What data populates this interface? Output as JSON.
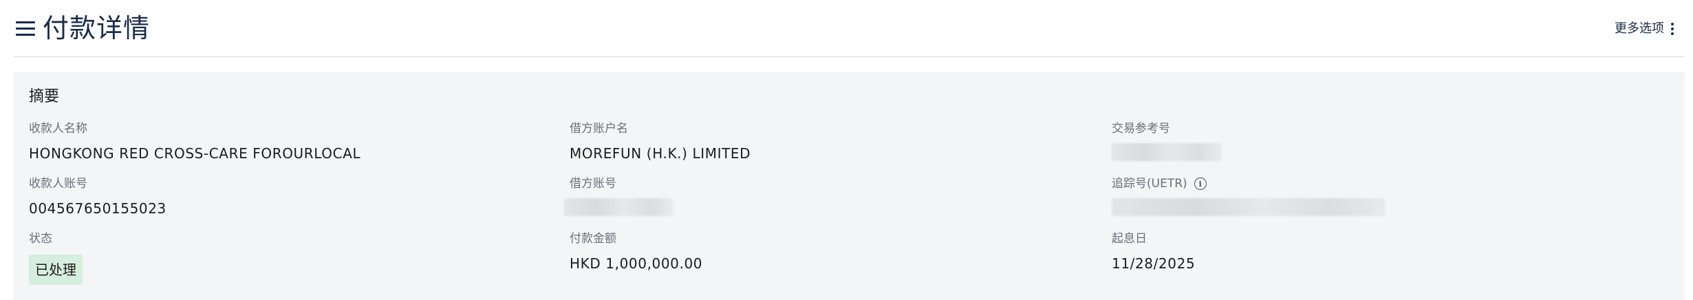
{
  "header": {
    "title": "付款详情",
    "more_options_label": "更多选项"
  },
  "summary": {
    "title": "摘要",
    "payee_name": {
      "label": "收款人名称",
      "value": "HONGKONG RED CROSS-CARE FOROURLOCAL"
    },
    "payee_account": {
      "label": "收款人账号",
      "value": "004567650155023"
    },
    "status": {
      "label": "状态",
      "value": "已处理"
    },
    "debit_account_name": {
      "label": "借方账户名",
      "value": "MOREFUN (H.K.) LIMITED"
    },
    "debit_account_number": {
      "label": "借方账号"
    },
    "payment_amount": {
      "label": "付款金额",
      "value": "HKD 1,000,000.00"
    },
    "transaction_reference": {
      "label": "交易参考号"
    },
    "tracking_number": {
      "label": "追踪号(UETR)"
    },
    "value_date": {
      "label": "起息日",
      "value": "11/28/2025"
    }
  },
  "colors": {
    "title_navy": "#1a2b49",
    "card_background": "#f3f5f7",
    "status_badge_green": "#d6eedd",
    "label_gray": "#6b6f76"
  },
  "icons": [
    "hamburger-menu-icon",
    "kebab-menu-icon",
    "info-icon"
  ]
}
